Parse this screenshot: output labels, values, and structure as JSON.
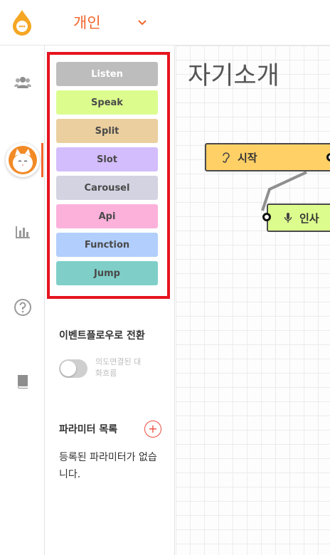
{
  "header": {
    "workspace_title": "개인"
  },
  "rail": {
    "items": [
      {
        "name": "team-icon"
      },
      {
        "name": "cat-avatar"
      },
      {
        "name": "chart-icon"
      },
      {
        "name": "help-icon"
      },
      {
        "name": "book-icon"
      }
    ],
    "active_index": 1
  },
  "palette": {
    "nodes": [
      {
        "label": "Listen",
        "bg": "#bdbdbd",
        "fg": "#ffffff"
      },
      {
        "label": "Speak",
        "bg": "#dcfd8e",
        "fg": "#4a4a4a"
      },
      {
        "label": "Split",
        "bg": "#ebcf9f",
        "fg": "#4a4a4a"
      },
      {
        "label": "Slot",
        "bg": "#d4bdfc",
        "fg": "#4a4a4a"
      },
      {
        "label": "Carousel",
        "bg": "#d3d3e2",
        "fg": "#4a4a4a"
      },
      {
        "label": "Api",
        "bg": "#fcb1db",
        "fg": "#4a4a4a"
      },
      {
        "label": "Function",
        "bg": "#b2cefc",
        "fg": "#4a4a4a"
      },
      {
        "label": "Jump",
        "bg": "#7fcfc8",
        "fg": "#4a4a4a"
      }
    ],
    "highlight_color": "#e5141f"
  },
  "event_flow": {
    "title": "이벤트플로우로 전환",
    "toggle_label": "의도연결된 대화흐름",
    "toggle_on": false
  },
  "params": {
    "title": "파라미터 목록",
    "empty_message": "등록된 파라미터가 없습니다."
  },
  "canvas": {
    "title": "자기소개",
    "nodes": [
      {
        "label": "시작",
        "icon": "ear-icon",
        "bg": "#ffd066"
      },
      {
        "label": "인사",
        "icon": "mic-icon",
        "bg": "#dcfd8e"
      }
    ]
  },
  "colors": {
    "accent": "#f2662b"
  }
}
